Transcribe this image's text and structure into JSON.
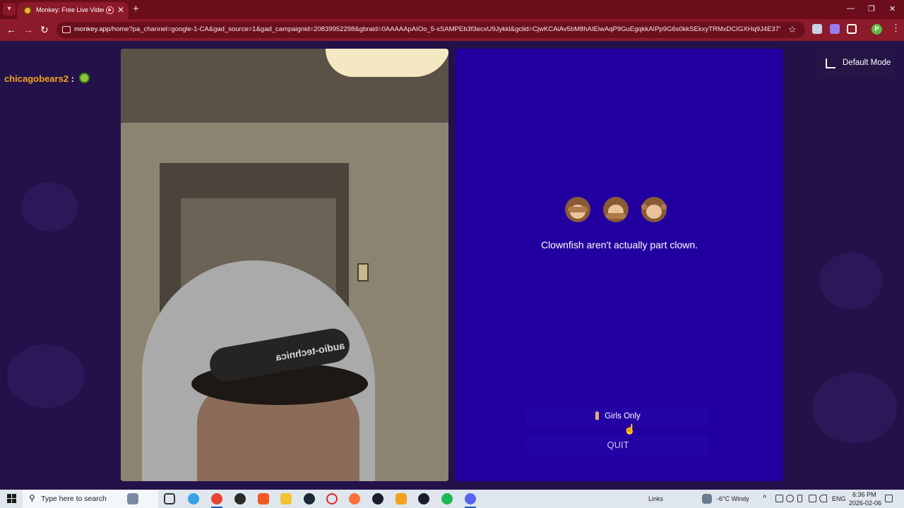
{
  "browser": {
    "tab_title": "Monkey: Free Live Video Ch",
    "tab_close": "✕",
    "new_tab": "+",
    "url_host": "monkey.app",
    "url_rest": "/home?pa_channel=google-1-CA&gad_source=1&gad_campaignid=20839952298&gbraid=0AAAAApAIOo_5-xSAMPEb3f3ecxU9Jykkl&gclid=CjwKCAiAv5bM8hAIEiwAqP9GuEgqkkAIPp9G6s0kkSEkxyTRMxDCIGXHq9J4E37Y4rY45pq...",
    "back": "←",
    "forward": "→",
    "reload": "↻",
    "star": "☆",
    "profile_initial": "P",
    "menu": "⋮",
    "window_min": "—",
    "window_restore": "❐",
    "window_close": "✕"
  },
  "chat": {
    "username": "chicagobears2",
    "separator": ":",
    "emoji_icon": "frog-emoji-icon"
  },
  "stranger": {
    "emoji_icons": [
      "see-no-evil-monkey-icon",
      "speak-no-evil-monkey-icon",
      "hear-no-evil-monkey-icon"
    ],
    "fact": "Clownfish aren't actually part clown.",
    "girls_only_label": "Girls Only",
    "quit_label": "QUIT"
  },
  "mode_button": {
    "label": "Default Mode"
  },
  "taskbar": {
    "search_placeholder": "Type here to search",
    "links_label": "Links",
    "weather": "-6°C  Windy",
    "language": "ENG",
    "time": "6:36 PM",
    "date": "2026-02-06",
    "pinned_icons": [
      "sandbox-icon",
      "task-view-icon",
      "copilot-icon",
      "chrome-icon",
      "nordvpn-icon",
      "brave-icon",
      "file-explorer-icon",
      "steam-icon",
      "opera-icon",
      "firefox-icon",
      "media-player-icon",
      "app-icon",
      "arc-icon",
      "arrow-app-icon",
      "spotify-icon",
      "discord-icon"
    ]
  },
  "colors": {
    "tab_bar": "#6b0d1a",
    "toolbar": "#8b1a2a",
    "page_bg": "#23124a",
    "stranger_panel": "#2200a0",
    "chat_username": "#f4a21d"
  }
}
